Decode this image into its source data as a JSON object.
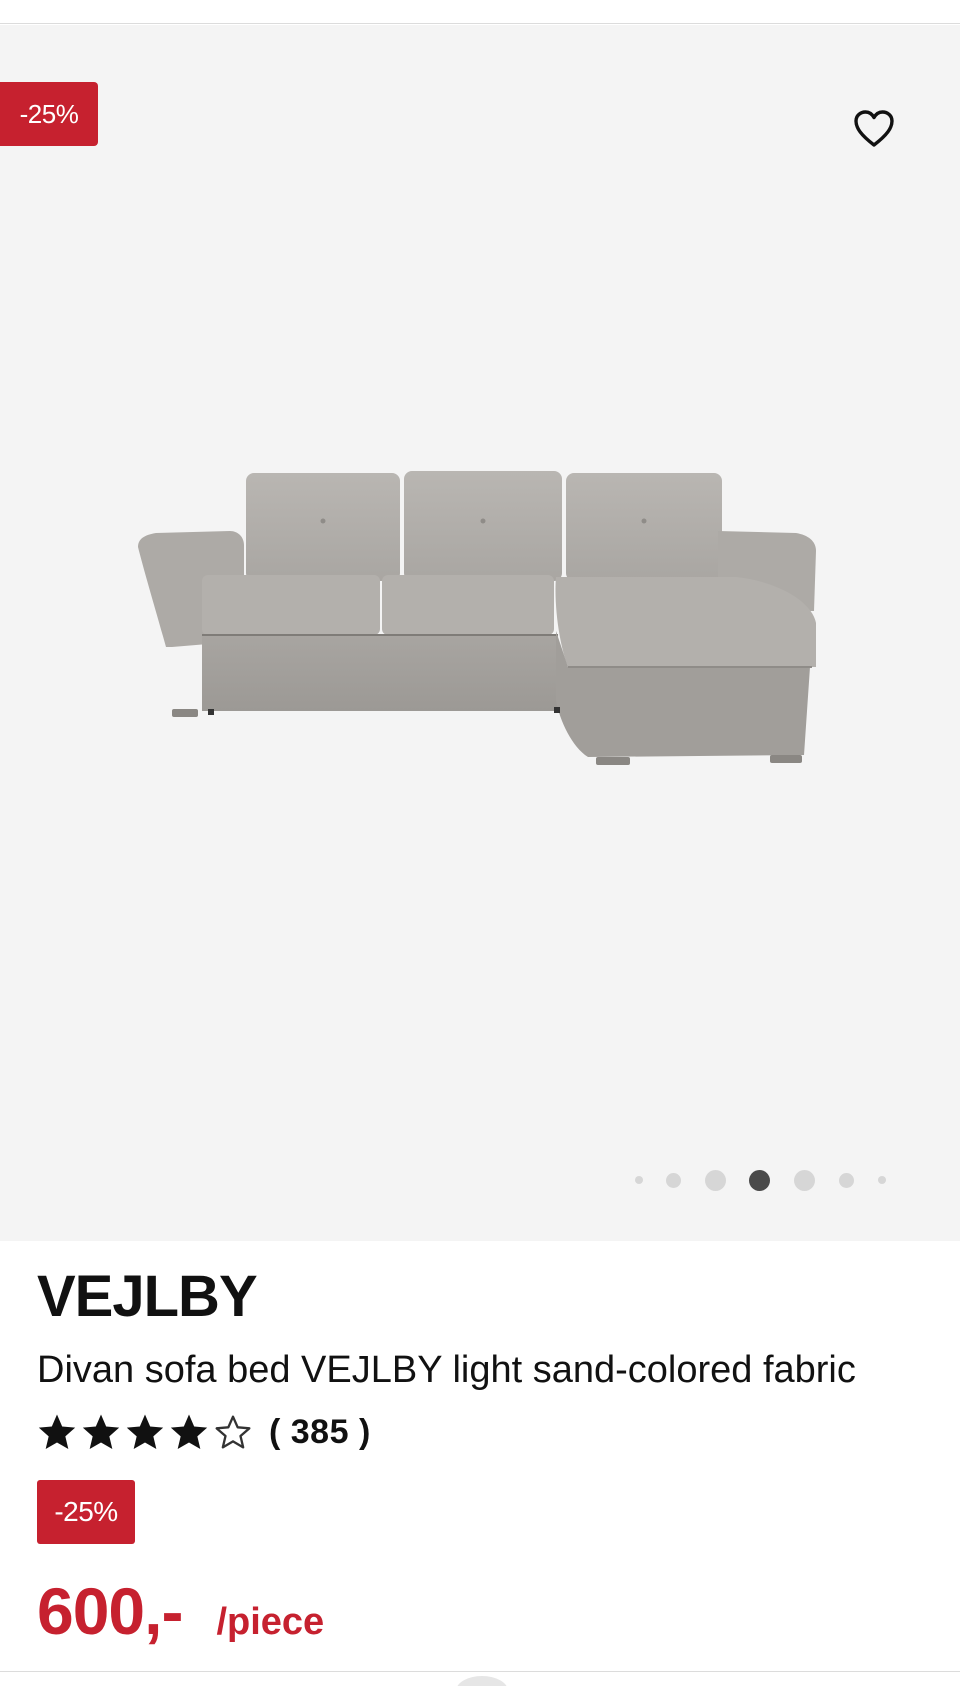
{
  "gallery": {
    "discount_badge": "-25%",
    "favorite_icon": "heart-outline-icon",
    "image_alt": "sofa-bed-product-image",
    "carousel_total": 7,
    "carousel_active_index": 3
  },
  "product": {
    "brand": "VEJLBY",
    "description": "Divan sofa bed VEJLBY light sand-colored fabric",
    "rating": {
      "score": 4,
      "max": 5,
      "count_label": "( 385 )"
    },
    "discount_badge": "-25%",
    "price": "600,-",
    "unit": "/piece"
  },
  "colors": {
    "accent_red": "#c6212f",
    "gallery_bg": "#f4f4f4",
    "text": "#111111"
  }
}
